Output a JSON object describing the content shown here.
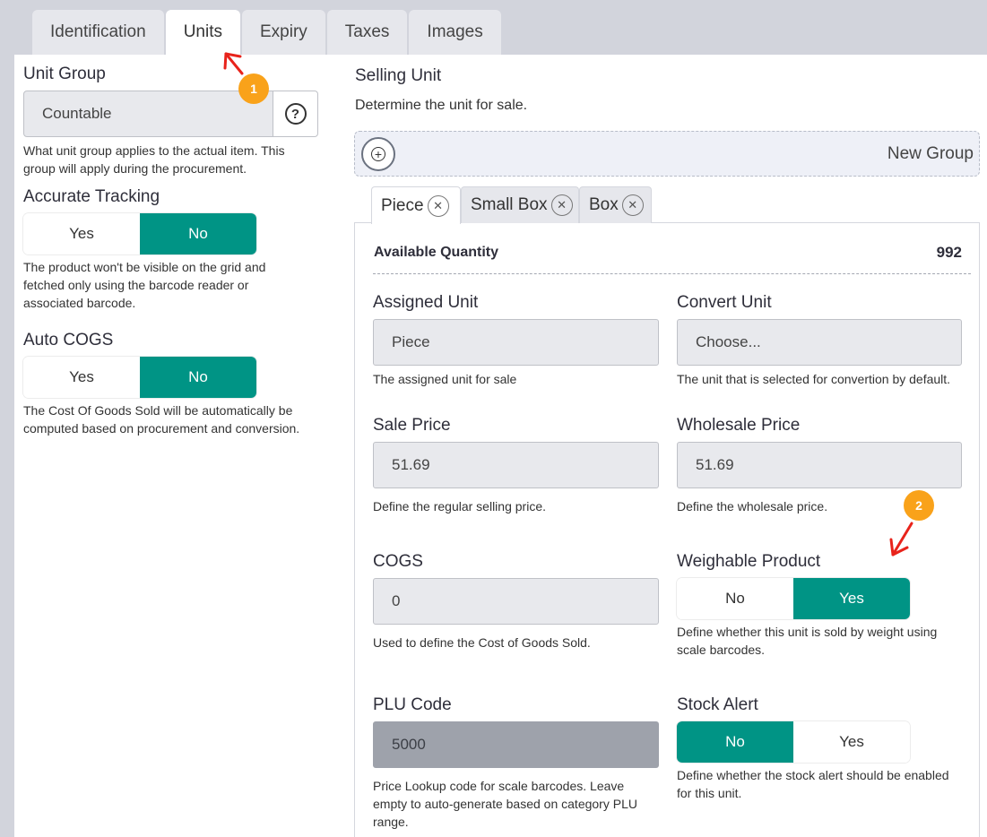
{
  "tabs": [
    {
      "label": "Identification"
    },
    {
      "label": "Units",
      "active": true
    },
    {
      "label": "Expiry"
    },
    {
      "label": "Taxes"
    },
    {
      "label": "Images"
    }
  ],
  "left": {
    "unit_group": {
      "label": "Unit Group",
      "value": "Countable",
      "help": "What unit group applies to the actual item. This group will apply during the procurement.",
      "help_icon": "question-circle-icon"
    },
    "accurate_tracking": {
      "label": "Accurate Tracking",
      "yes": "Yes",
      "no": "No",
      "selected": "No",
      "help": "The product won't be visible on the grid and fetched only using the barcode reader or associated barcode."
    },
    "auto_cogs": {
      "label": "Auto COGS",
      "yes": "Yes",
      "no": "No",
      "selected": "No",
      "help": "The Cost Of Goods Sold will be automatically be computed based on procurement and conversion."
    }
  },
  "selling": {
    "title": "Selling Unit",
    "subtitle": "Determine the unit for sale.",
    "new_group": "New Group",
    "unit_tabs": [
      {
        "label": "Piece",
        "active": true
      },
      {
        "label": "Small Box"
      },
      {
        "label": "Box"
      }
    ],
    "available_quantity": {
      "label": "Available Quantity",
      "value": "992"
    },
    "assigned_unit": {
      "label": "Assigned Unit",
      "value": "Piece",
      "help": "The assigned unit for sale"
    },
    "convert_unit": {
      "label": "Convert Unit",
      "value": "Choose...",
      "help": "The unit that is selected for convertion by default."
    },
    "sale_price": {
      "label": "Sale Price",
      "value": "51.69",
      "help": "Define the regular selling price."
    },
    "wholesale_price": {
      "label": "Wholesale Price",
      "value": "51.69",
      "help": "Define the wholesale price."
    },
    "cogs": {
      "label": "COGS",
      "value": "0",
      "help": "Used to define the Cost of Goods Sold."
    },
    "weighable": {
      "label": "Weighable Product",
      "no": "No",
      "yes": "Yes",
      "selected": "Yes",
      "help": "Define whether this unit is sold by weight using scale barcodes."
    },
    "plu_code": {
      "label": "PLU Code",
      "value": "5000",
      "help": "Price Lookup code for scale barcodes. Leave empty to auto-generate based on category PLU range."
    },
    "stock_alert": {
      "label": "Stock Alert",
      "no": "No",
      "yes": "Yes",
      "selected": "No",
      "help": "Define whether the stock alert should be enabled for this unit."
    }
  },
  "annotations": {
    "marker_1": "1",
    "marker_2": "2",
    "arrow_color": "#e8231b",
    "marker_color": "#f9a21a"
  },
  "colors": {
    "accent": "#009485",
    "background": "#d2d4dc"
  }
}
